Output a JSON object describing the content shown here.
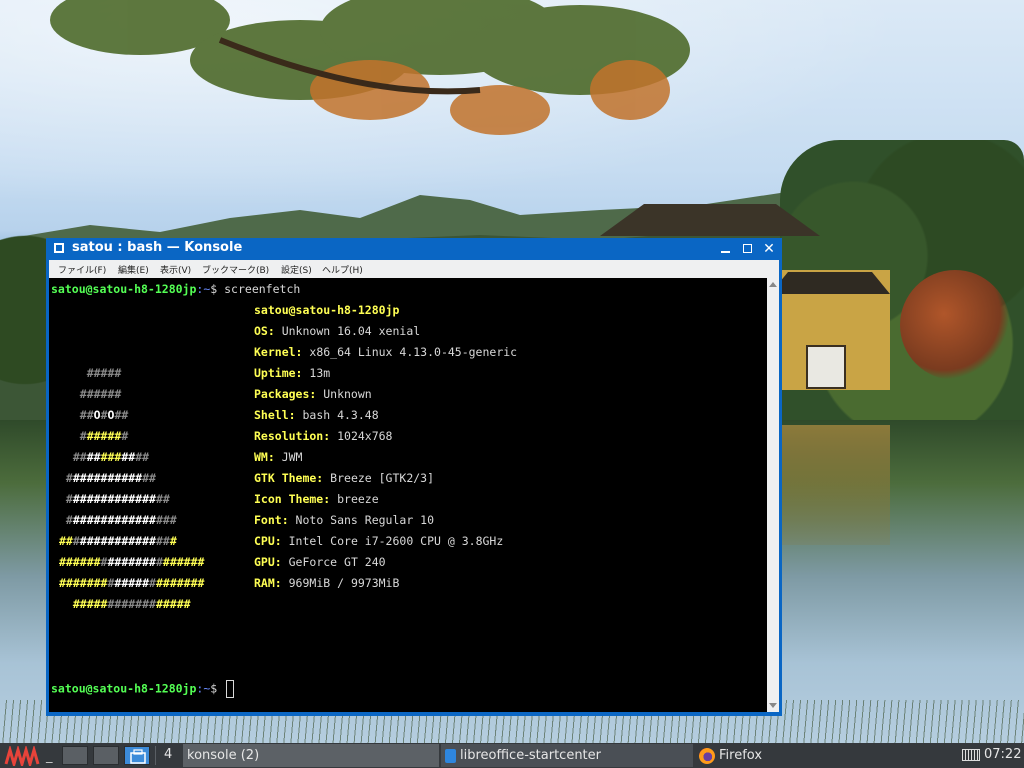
{
  "window": {
    "title": "satou : bash — Konsole",
    "menu": [
      "ファイル(F)",
      "編集(E)",
      "表示(V)",
      "ブックマーク(B)",
      "設定(S)",
      "ヘルプ(H)"
    ]
  },
  "terminal": {
    "prompt_user": "satou@satou-h8-1280jp",
    "prompt_path": ":~",
    "prompt_symbol": "$",
    "command": " screenfetch",
    "user_host": "satou@satou-h8-1280jp",
    "info": [
      {
        "key": "OS:",
        "value": " Unknown 16.04 xenial"
      },
      {
        "key": "Kernel:",
        "value": " x86_64 Linux 4.13.0-45-generic"
      },
      {
        "key": "Uptime:",
        "value": " 13m"
      },
      {
        "key": "Packages:",
        "value": " Unknown"
      },
      {
        "key": "Shell:",
        "value": " bash 4.3.48"
      },
      {
        "key": "Resolution:",
        "value": " 1024x768"
      },
      {
        "key": "WM:",
        "value": " JWM"
      },
      {
        "key": "GTK Theme:",
        "value": " Breeze [GTK2/3]"
      },
      {
        "key": "Icon Theme:",
        "value": " breeze"
      },
      {
        "key": "Font:",
        "value": " Noto Sans Regular 10"
      },
      {
        "key": "CPU:",
        "value": " Intel Core i7-2600 CPU @ 3.8GHz"
      },
      {
        "key": "GPU:",
        "value": " GeForce GT 240"
      },
      {
        "key": "RAM:",
        "value": " 969MiB / 9973MiB"
      }
    ],
    "logo": [
      [
        [
          "d",
          "    #####"
        ]
      ],
      [
        [
          "d",
          "   ######"
        ]
      ],
      [
        [
          "d",
          "   ##"
        ],
        [
          "w",
          "O"
        ],
        [
          "d",
          "#"
        ],
        [
          "w",
          "O"
        ],
        [
          "d",
          "##"
        ]
      ],
      [
        [
          "d",
          "   #"
        ],
        [
          "y",
          "#####"
        ],
        [
          "d",
          "#"
        ]
      ],
      [
        [
          "d",
          "  ##"
        ],
        [
          "w",
          "##"
        ],
        [
          "y",
          "###"
        ],
        [
          "w",
          "##"
        ],
        [
          "d",
          "##"
        ]
      ],
      [
        [
          "d",
          " #"
        ],
        [
          "w",
          "##########"
        ],
        [
          "d",
          "##"
        ]
      ],
      [
        [
          "d",
          " #"
        ],
        [
          "w",
          "############"
        ],
        [
          "d",
          "##"
        ]
      ],
      [
        [
          "d",
          " #"
        ],
        [
          "w",
          "############"
        ],
        [
          "d",
          "###"
        ]
      ],
      [
        [
          "y",
          "##"
        ],
        [
          "d",
          "#"
        ],
        [
          "w",
          "###########"
        ],
        [
          "d",
          "##"
        ],
        [
          "y",
          "#"
        ]
      ],
      [
        [
          "y",
          "######"
        ],
        [
          "d",
          "#"
        ],
        [
          "w",
          "#######"
        ],
        [
          "d",
          "#"
        ],
        [
          "y",
          "######"
        ]
      ],
      [
        [
          "y",
          "#######"
        ],
        [
          "d",
          "#"
        ],
        [
          "w",
          "#####"
        ],
        [
          "d",
          "#"
        ],
        [
          "y",
          "#######"
        ]
      ],
      [
        [
          "y",
          "  #####"
        ],
        [
          "d",
          "#######"
        ],
        [
          "y",
          "#####"
        ]
      ]
    ]
  },
  "taskbar": {
    "workspace_number": "4",
    "minimize_all": "_",
    "tasks": [
      "konsole (2)",
      "libreoffice-startcenter",
      "Firefox"
    ],
    "clock": "07:22"
  },
  "icons": [
    "window-menu-icon",
    "minimize-icon",
    "maximize-icon",
    "close-icon",
    "jwm-logo-icon",
    "keyboard-icon",
    "firefox-icon",
    "libreoffice-icon",
    "files-icon"
  ]
}
